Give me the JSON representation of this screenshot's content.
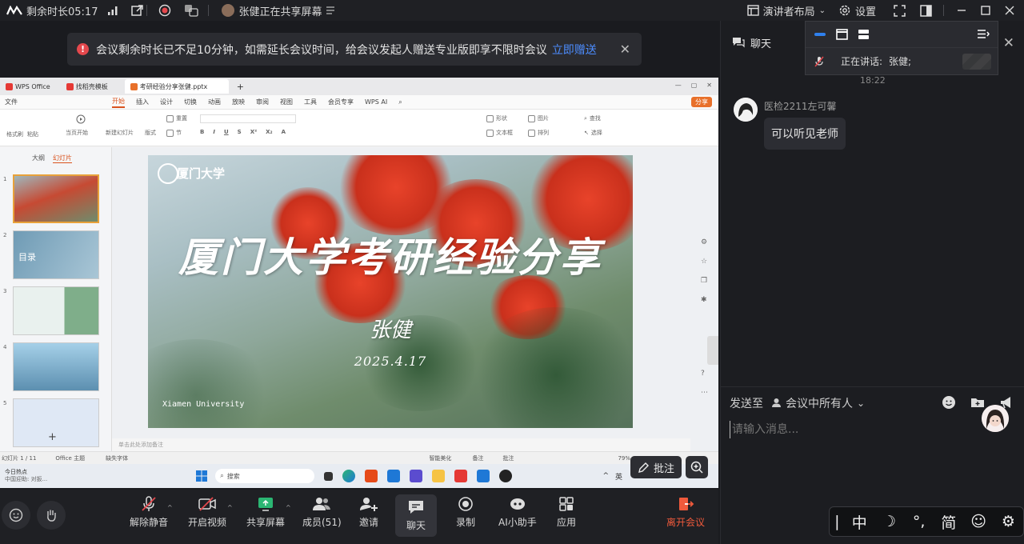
{
  "topbar": {
    "remaining_time": "剩余时长05:17",
    "sharing_user": "张健正在共享屏幕",
    "presenter_layout": "演讲者布局",
    "settings": "设置"
  },
  "banner": {
    "message": "会议剩余时长已不足10分钟，如需延长会议时间，给会议发起人赠送专业版即享不限时会议",
    "link": "立即赠送"
  },
  "wps": {
    "tabs": [
      "WPS Office",
      "找稻壳模板",
      "考研经验分享张健.pptx"
    ],
    "menu": [
      "文件",
      "开始",
      "插入",
      "设计",
      "切换",
      "动画",
      "放映",
      "审阅",
      "视图",
      "工具",
      "会员专享",
      "WPS AI"
    ],
    "share_label": "分享",
    "ribbon": {
      "from_current": "当页开始",
      "new_slide": "新建幻灯片",
      "layout": "版式",
      "reset": "重置",
      "section": "节",
      "shape": "形状",
      "picture": "图片",
      "textbox": "文本框",
      "arrange": "排列",
      "find": "查找",
      "select": "选择",
      "paste": "格式刷",
      "paste2": "粘贴"
    },
    "panel_tabs": [
      "大纲",
      "幻灯片"
    ],
    "thumb_numbers": [
      "1",
      "2",
      "3",
      "4",
      "5"
    ],
    "thumb2_title": "目录",
    "notes_placeholder": "单击此处添加备注",
    "status": {
      "slide_count": "幻灯片 1 / 11",
      "theme": "Office 主题",
      "missing_font": "缺失字体",
      "smart_beautify": "智能美化",
      "notes": "备注",
      "comments": "批注",
      "zoom": "79%"
    }
  },
  "slide": {
    "university": "厦门大学",
    "title": "厦门大学考研经验分享",
    "presenter": "张健",
    "date": "2025.4.17",
    "english": "Xiamen University"
  },
  "taskbar": {
    "search": "搜索",
    "news_title": "今日热点",
    "news_sub": "中国迎助: 对扳...",
    "lang": "英"
  },
  "annotate": "批注",
  "bottombar": {
    "unmute": "解除静音",
    "start_video": "开启视频",
    "share_screen": "共享屏幕",
    "members": "成员(51)",
    "invite": "邀请",
    "chat": "聊天",
    "record": "录制",
    "ai_assistant": "AI小助手",
    "apps": "应用",
    "leave": "离开会议"
  },
  "chat": {
    "title": "聊天",
    "speaking_label": "正在讲话:",
    "speaking_name": "张健;",
    "time": "18:22",
    "sender": "医检2211左可馨",
    "message": "可以听见老师",
    "send_to_label": "发送至",
    "send_to_target": "会议中所有人",
    "input_placeholder": "请输入消息..."
  },
  "ime": {
    "chinese": "中",
    "simplified": "简"
  },
  "colors": {
    "accent": "#4c8dff",
    "leave": "#f05a3c",
    "warning": "#e5484d",
    "wps_orange": "#d9531e"
  }
}
